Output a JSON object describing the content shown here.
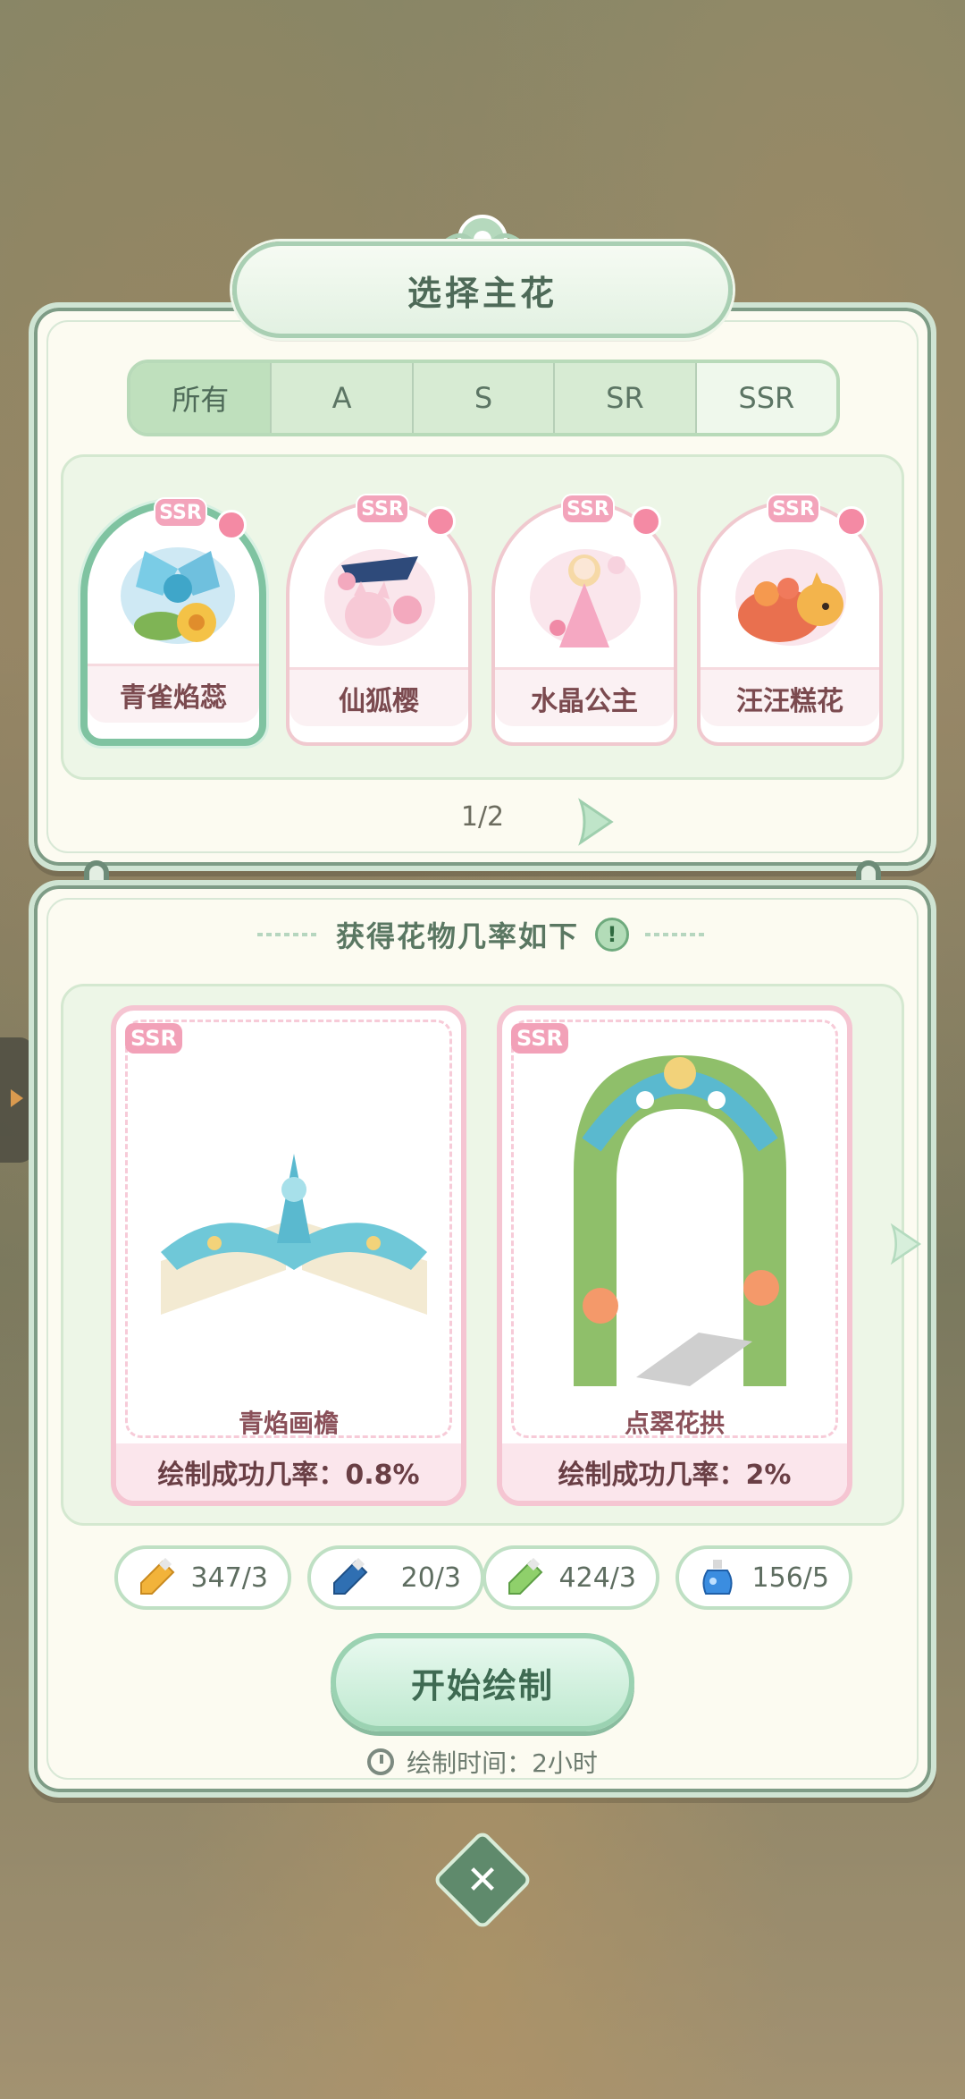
{
  "dialog": {
    "title": "选择主花",
    "tabs": [
      "所有",
      "A",
      "S",
      "SR",
      "SSR"
    ],
    "active_tab": "所有",
    "page_indicator": "1/2",
    "flowers": [
      {
        "rarity": "SSR",
        "name": "青雀焰蕊",
        "selected": true
      },
      {
        "rarity": "SSR",
        "name": "仙狐樱",
        "selected": false
      },
      {
        "rarity": "SSR",
        "name": "水晶公主",
        "selected": false
      },
      {
        "rarity": "SSR",
        "name": "汪汪糕花",
        "selected": false
      }
    ]
  },
  "odds": {
    "title": "获得花物几率如下",
    "info_icon": "!",
    "items": [
      {
        "rarity": "SSR",
        "name": "青焰画檐",
        "rate": "绘制成功几率：0.8%"
      },
      {
        "rarity": "SSR",
        "name": "点翠花拱",
        "rate": "绘制成功几率：2%"
      }
    ]
  },
  "resources": [
    {
      "icon": "yellow-paint-tube-icon",
      "value": "347/3",
      "color": "#f2b33a"
    },
    {
      "icon": "blue-paint-tube-icon",
      "value": "20/3",
      "color": "#2f6fb2"
    },
    {
      "icon": "green-paint-tube-icon",
      "value": "424/3",
      "color": "#8fd06b"
    },
    {
      "icon": "blue-potion-icon",
      "value": "156/5",
      "color": "#3b8de0"
    }
  ],
  "actions": {
    "start_label": "开始绘制",
    "time_label": "绘制时间：2小时",
    "close_symbol": "✕"
  },
  "colors": {
    "accent_green": "#7fc3a1",
    "panel_bg": "#fcfbf1",
    "ssr_pink": "#f2a1b8"
  }
}
